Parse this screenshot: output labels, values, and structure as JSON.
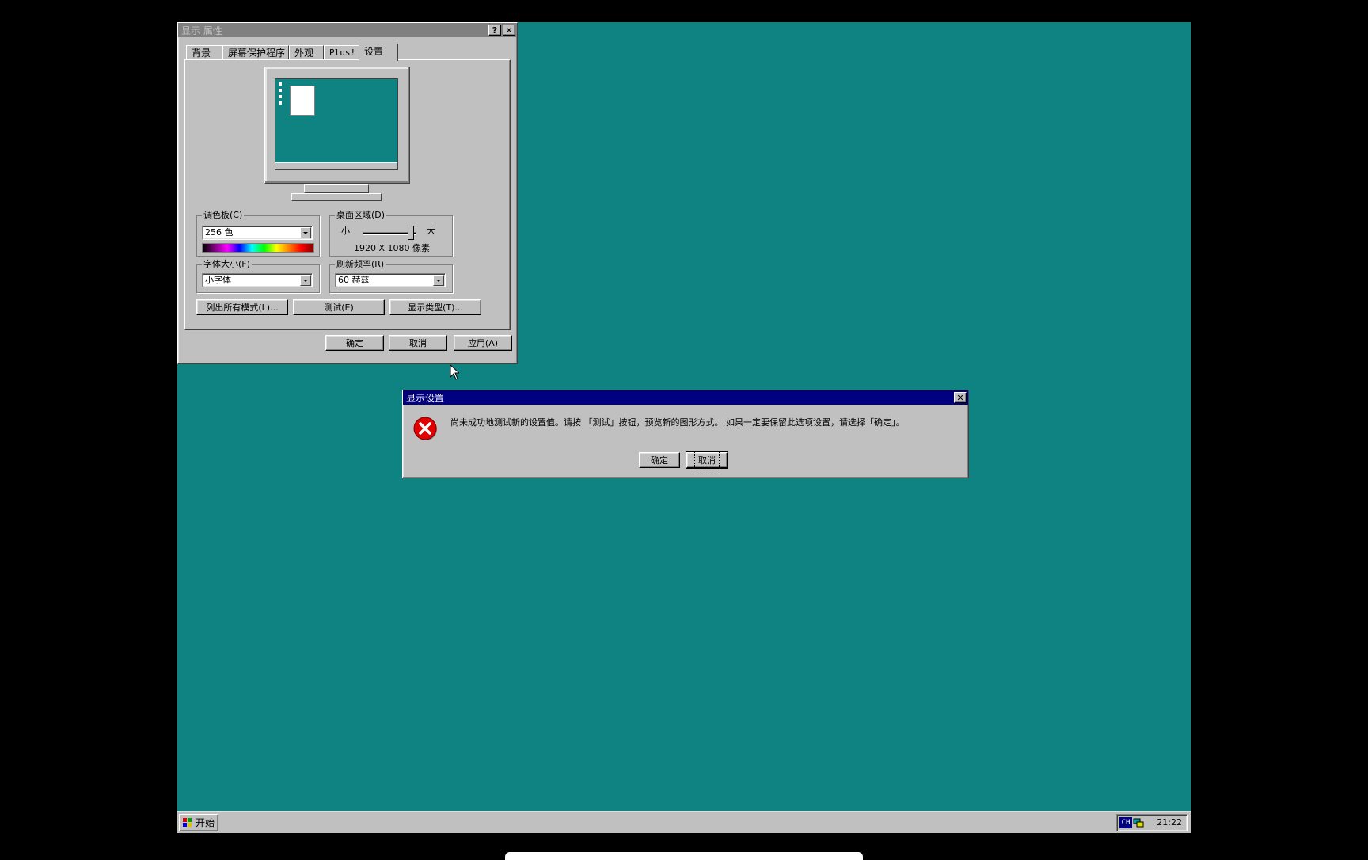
{
  "display_properties": {
    "title": "显示 属性",
    "help_btn": "?",
    "close_btn": "✕",
    "tabs": [
      "背景",
      "屏幕保护程序",
      "外观",
      "Plus!",
      "设置"
    ],
    "palette": {
      "label": "调色板(C)",
      "value": "256 色"
    },
    "desktop_area": {
      "label": "桌面区域(D)",
      "min_label": "小",
      "max_label": "大",
      "resolution": "1920 X 1080 像素"
    },
    "font_size": {
      "label": "字体大小(F)",
      "value": "小字体"
    },
    "refresh_rate": {
      "label": "刷新频率(R)",
      "value": "60 赫兹"
    },
    "buttons": {
      "list_modes": "列出所有模式(L)...",
      "test": "测试(E)",
      "display_type": "显示类型(T)..."
    },
    "ok": "确定",
    "cancel": "取消",
    "apply": "应用(A)"
  },
  "dialog": {
    "title": "显示设置",
    "close_btn": "✕",
    "message": "尚未成功地测试新的设置值。请按 「测试」按钮，预览新的图形方式。 如果一定要保留此选项设置，请选择「确定」。",
    "ok": "确定",
    "cancel": "取消"
  },
  "taskbar": {
    "start": "开始",
    "ime": "CH",
    "clock": "21:22"
  }
}
